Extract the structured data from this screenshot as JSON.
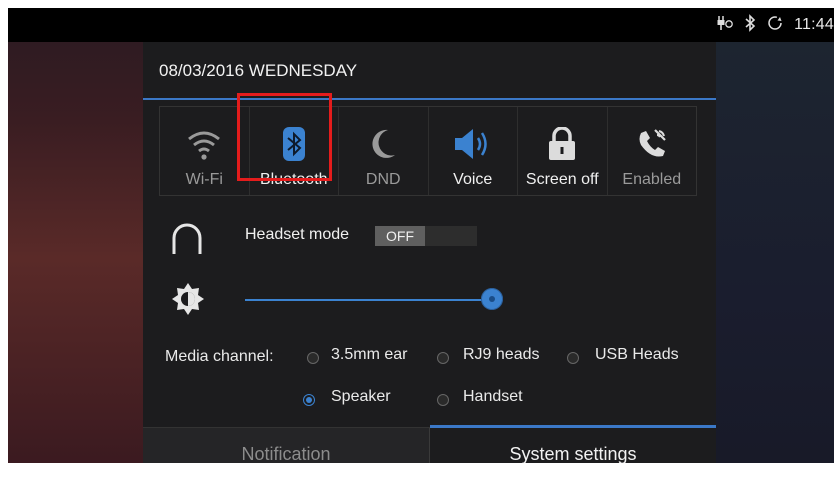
{
  "status_bar": {
    "icons": [
      "usb-charging-icon",
      "bluetooth-icon",
      "sync-icon"
    ],
    "time": "11:44"
  },
  "panel": {
    "date": "08/03/2016 WEDNESDAY",
    "toggles": [
      {
        "id": "wifi",
        "label": "Wi-Fi",
        "icon": "wifi-icon",
        "active": false
      },
      {
        "id": "bluetooth",
        "label": "Bluetooth",
        "icon": "bluetooth-icon",
        "active": true
      },
      {
        "id": "dnd",
        "label": "DND",
        "icon": "moon-icon",
        "active": false
      },
      {
        "id": "voice",
        "label": "Voice",
        "icon": "speaker-icon",
        "active": true
      },
      {
        "id": "screen_off",
        "label": "Screen off",
        "icon": "lock-icon",
        "active": true
      },
      {
        "id": "enabled",
        "label": "Enabled",
        "icon": "call-forward-icon",
        "active": false
      }
    ],
    "headset": {
      "label": "Headset mode",
      "state": "OFF"
    },
    "brightness": {
      "icon": "brightness-icon",
      "level": 1.0
    },
    "media": {
      "label": "Media channel:",
      "options": [
        {
          "label": "3.5mm ear",
          "selected": false
        },
        {
          "label": "RJ9 heads",
          "selected": false
        },
        {
          "label": "USB Heads",
          "selected": false
        },
        {
          "label": "Speaker",
          "selected": true
        },
        {
          "label": "Handset",
          "selected": false
        }
      ]
    },
    "tabs": {
      "notification": "Notification",
      "system": "System settings"
    }
  },
  "colors": {
    "accent": "#3b82d0",
    "highlight": "#e41c1c"
  }
}
